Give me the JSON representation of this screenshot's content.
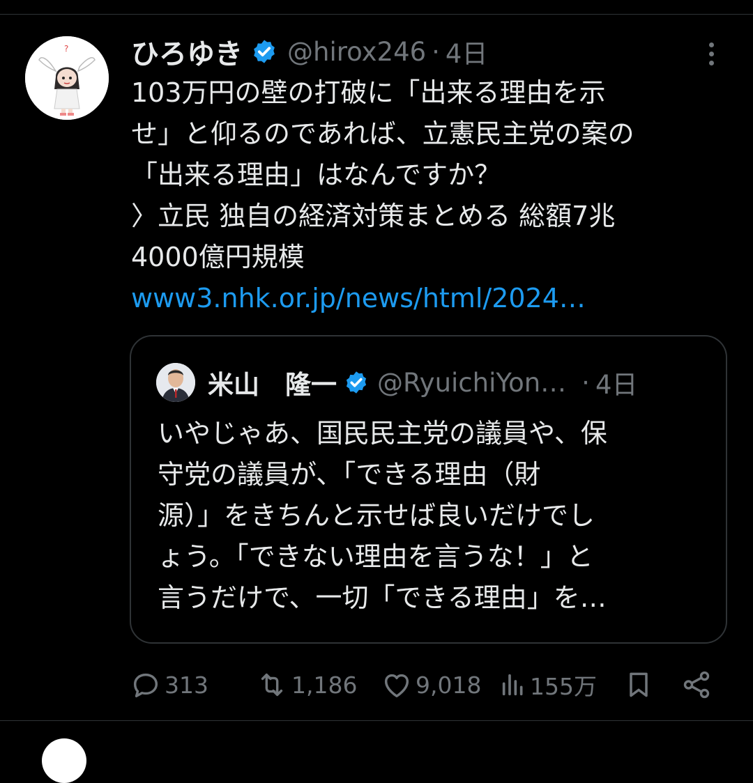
{
  "tweet": {
    "author_name": "ひろゆき",
    "handle": "@hirox246",
    "separator": "·",
    "time": "4日",
    "text_lines": [
      "103万円の壁の打破に「出来る理由を示",
      "せ」と仰るのであれば、立憲民主党の案の",
      "「出来る理由」はなんですか？",
      "〉立民 独自の経済対策まとめる 総額7兆",
      "4000億円規模"
    ],
    "link": "www3.nhk.or.jp/news/html/2024…"
  },
  "quote": {
    "author_name": "米山　隆一",
    "handle": "@RyuichiYon…",
    "separator": "·",
    "time": "4日",
    "text_lines": [
      "いやじゃあ、国民民主党の議員や、保",
      "守党の議員が、「できる理由（財",
      "源）」をきちんと示せば良いだけでし",
      "ょう。「できない理由を言うな！」と",
      "言うだけで、一切「できる理由」を…"
    ]
  },
  "actions": {
    "reply_count": "313",
    "retweet_count": "1,186",
    "like_count": "9,018",
    "views_count": "155万"
  },
  "icons": {
    "verified": "verified-badge-icon",
    "more": "more-icon",
    "reply": "reply-icon",
    "retweet": "retweet-icon",
    "like": "heart-icon",
    "views": "views-icon",
    "bookmark": "bookmark-icon",
    "share": "share-icon"
  },
  "colors": {
    "background": "#000000",
    "text": "#e7e9ea",
    "secondary": "#71767b",
    "link": "#1d9bf0",
    "border": "#2f3336"
  }
}
